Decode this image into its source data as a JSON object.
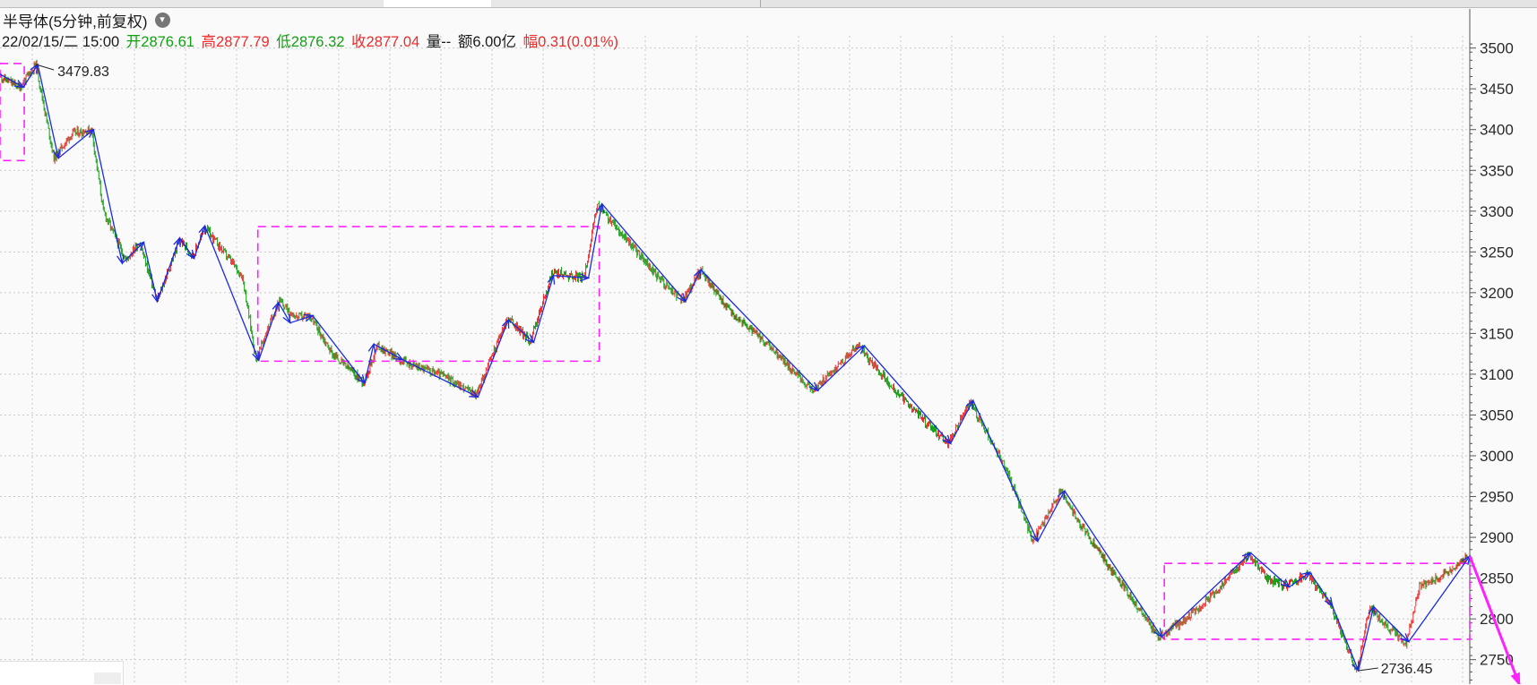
{
  "header": {
    "title": "半导体(5分钟,前复权)",
    "menu_icon": "chevron-down-icon",
    "date": "22/02/15/二 15:00",
    "open_label": "开",
    "open_value": "2876.61",
    "high_label": "高",
    "high_value": "2877.79",
    "low_label": "低",
    "low_value": "2876.32",
    "close_label": "收",
    "close_value": "2877.04",
    "volume_label": "量--",
    "amount_label": "额",
    "amount_value": "6.00亿",
    "change_label": "幅",
    "change_value": "0.31(0.01%)"
  },
  "colors": {
    "up": "#ee2a2a",
    "down": "#13a013",
    "zigzag": "#1a2be0",
    "box": "#ff22ff",
    "grid": "#c8c8c8",
    "axis": "#555555"
  },
  "annotations": {
    "max_label": "3479.83",
    "min_label": "2736.45"
  },
  "chart_data": {
    "type": "line",
    "subtype": "candlestick price series with zigzag swing overlay and consolidation boxes",
    "ylim": [
      2720,
      3515
    ],
    "y_ticks": [
      3500,
      3450,
      3400,
      3350,
      3300,
      3250,
      3200,
      3150,
      3100,
      3050,
      3000,
      2950,
      2900,
      2850,
      2800,
      2750
    ],
    "y_tick_labels": [
      "3500",
      "3450",
      "3400",
      "3350",
      "3300",
      "3250",
      "3200",
      "3150",
      "3100",
      "3050",
      "3000",
      "2950",
      "2900",
      "2850",
      "2800",
      "2750"
    ],
    "x_count": 1500,
    "grid": true,
    "price_series": [
      [
        0,
        3465
      ],
      [
        22,
        3452
      ],
      [
        40,
        3479.83
      ],
      [
        60,
        3365
      ],
      [
        80,
        3395
      ],
      [
        102,
        3400
      ],
      [
        115,
        3300
      ],
      [
        140,
        3240
      ],
      [
        155,
        3262
      ],
      [
        175,
        3190
      ],
      [
        200,
        3265
      ],
      [
        215,
        3245
      ],
      [
        228,
        3280
      ],
      [
        270,
        3220
      ],
      [
        285,
        3118
      ],
      [
        310,
        3190
      ],
      [
        330,
        3170
      ],
      [
        345,
        3172
      ],
      [
        370,
        3125
      ],
      [
        405,
        3090
      ],
      [
        420,
        3135
      ],
      [
        450,
        3115
      ],
      [
        490,
        3100
      ],
      [
        530,
        3075
      ],
      [
        565,
        3170
      ],
      [
        590,
        3140
      ],
      [
        615,
        3225
      ],
      [
        650,
        3218
      ],
      [
        665,
        3307
      ],
      [
        700,
        3262
      ],
      [
        730,
        3222
      ],
      [
        760,
        3190
      ],
      [
        780,
        3228
      ],
      [
        810,
        3180
      ],
      [
        860,
        3130
      ],
      [
        905,
        3080
      ],
      [
        955,
        3135
      ],
      [
        1000,
        3075
      ],
      [
        1055,
        3015
      ],
      [
        1080,
        3065
      ],
      [
        1120,
        2985
      ],
      [
        1150,
        2895
      ],
      [
        1180,
        2955
      ],
      [
        1230,
        2870
      ],
      [
        1290,
        2778
      ],
      [
        1320,
        2800
      ],
      [
        1350,
        2830
      ],
      [
        1390,
        2880
      ],
      [
        1410,
        2850
      ],
      [
        1430,
        2840
      ],
      [
        1455,
        2855
      ],
      [
        1480,
        2818
      ],
      [
        1510,
        2736.45
      ],
      [
        1525,
        2815
      ],
      [
        1545,
        2790
      ],
      [
        1565,
        2770
      ],
      [
        1580,
        2840
      ],
      [
        1610,
        2855
      ],
      [
        1633,
        2877.04
      ]
    ],
    "zigzag": [
      [
        0,
        3468
      ],
      [
        26,
        3452
      ],
      [
        42,
        3479.83
      ],
      [
        65,
        3365
      ],
      [
        104,
        3400
      ],
      [
        136,
        3236
      ],
      [
        160,
        3262
      ],
      [
        175,
        3189
      ],
      [
        200,
        3267
      ],
      [
        216,
        3242
      ],
      [
        228,
        3282
      ],
      [
        288,
        3117
      ],
      [
        310,
        3188
      ],
      [
        323,
        3163
      ],
      [
        348,
        3172
      ],
      [
        406,
        3089
      ],
      [
        416,
        3137
      ],
      [
        448,
        3118
      ],
      [
        532,
        3072
      ],
      [
        566,
        3167
      ],
      [
        594,
        3139
      ],
      [
        616,
        3221
      ],
      [
        655,
        3218
      ],
      [
        670,
        3309
      ],
      [
        763,
        3189
      ],
      [
        780,
        3228
      ],
      [
        910,
        3080
      ],
      [
        962,
        3135
      ],
      [
        1058,
        3015
      ],
      [
        1083,
        3068
      ],
      [
        1155,
        2895
      ],
      [
        1185,
        2957
      ],
      [
        1293,
        2778
      ],
      [
        1392,
        2881
      ],
      [
        1435,
        2839
      ],
      [
        1458,
        2857
      ],
      [
        1483,
        2816
      ],
      [
        1512,
        2736.45
      ],
      [
        1529,
        2815
      ],
      [
        1568,
        2772
      ],
      [
        1636,
        2877
      ]
    ],
    "boxes": [
      {
        "x0": 0,
        "x1": 27,
        "y_top": 3481,
        "y_bottom": 3362
      },
      {
        "x0": 287,
        "x1": 667,
        "y_top": 3281,
        "y_bottom": 3116
      },
      {
        "x0": 1296,
        "x1": 1636,
        "y_top": 2868,
        "y_bottom": 2775
      }
    ],
    "projection": {
      "from": [
        1636,
        2877
      ],
      "to": [
        1692,
        2717
      ]
    }
  }
}
